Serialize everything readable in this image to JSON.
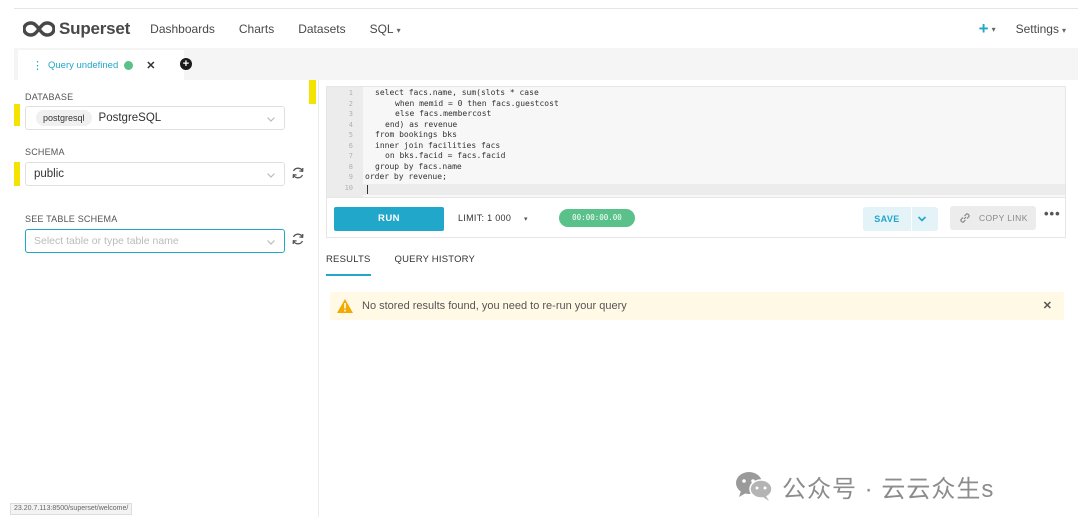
{
  "app": {
    "brand": "Superset",
    "nav": [
      {
        "label": "Dashboards"
      },
      {
        "label": "Charts"
      },
      {
        "label": "Datasets"
      },
      {
        "label": "SQL"
      }
    ],
    "right": {
      "add_icon": "plus-icon",
      "settings_label": "Settings"
    }
  },
  "tabs": {
    "active_tab_label": "Query undefined",
    "status_color": "#59c189"
  },
  "left_panel": {
    "database_label": "DATABASE",
    "database_tag": "postgresql",
    "database_value": "PostgreSQL",
    "schema_label": "SCHEMA",
    "schema_value": "public",
    "table_label": "SEE TABLE SCHEMA",
    "table_placeholder": "Select table or type table name"
  },
  "editor": {
    "lines": [
      "1",
      "2",
      "3",
      "4",
      "5",
      "6",
      "7",
      "8",
      "9",
      "10"
    ],
    "code": [
      "select facs.name, sum(slots * case",
      "when memid = 0 then facs.guestcost",
      "else facs.membercost",
      "end) as revenue",
      "from bookings bks",
      "inner join facilities facs",
      "on bks.facid = facs.facid",
      "group by facs.name",
      "order by revenue;",
      ""
    ]
  },
  "toolbar": {
    "run_label": "RUN",
    "limit_label": "LIMIT:",
    "limit_value": "1 000",
    "timer": "00:00:00.00",
    "save_label": "SAVE",
    "copy_link_label": "COPY LINK"
  },
  "results": {
    "tabs": [
      "RESULTS",
      "QUERY HISTORY"
    ],
    "alert_text": "No stored results found, you need to re-run your query"
  },
  "status_url": "23.20.7.113:8500/superset/welcome/",
  "watermark": "公众号 · 云云众生s",
  "colors": {
    "accent": "#20a7c9",
    "success": "#59c189",
    "warning_bg": "#fff9e6",
    "marker": "#f4e200"
  }
}
